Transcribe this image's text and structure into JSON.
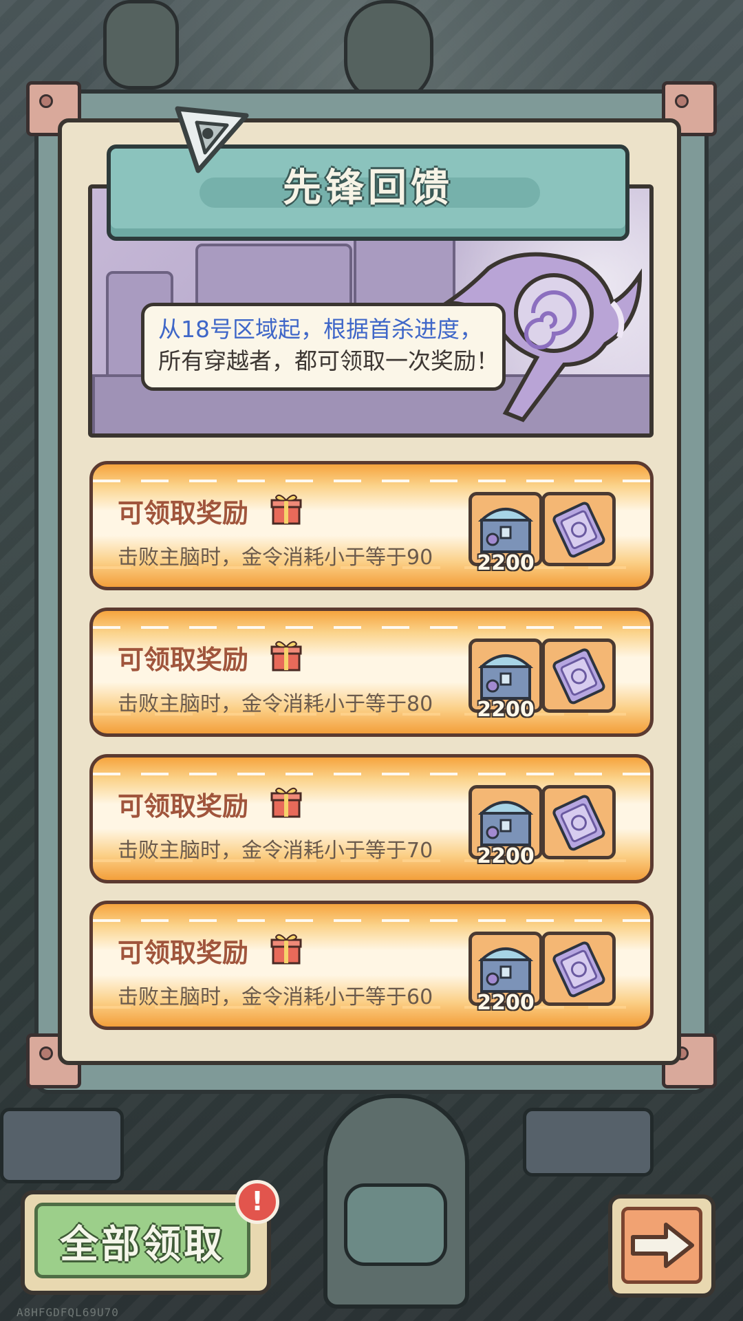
{
  "panel": {
    "title": "先锋回馈"
  },
  "banner": {
    "line1": "从18号区域起，根据首杀进度，",
    "line2": "所有穿越者，都可领取一次奖励！"
  },
  "rewards": [
    {
      "status": "可领取奖励",
      "description": "击败主脑时，金令消耗小于等于90",
      "items": [
        {
          "icon": "treasure-chest-icon",
          "quantity": "2200"
        },
        {
          "icon": "card-icon"
        }
      ]
    },
    {
      "status": "可领取奖励",
      "description": "击败主脑时，金令消耗小于等于80",
      "items": [
        {
          "icon": "treasure-chest-icon",
          "quantity": "2200"
        },
        {
          "icon": "card-icon"
        }
      ]
    },
    {
      "status": "可领取奖励",
      "description": "击败主脑时，金令消耗小于等于70",
      "items": [
        {
          "icon": "treasure-chest-icon",
          "quantity": "2200"
        },
        {
          "icon": "card-icon"
        }
      ]
    },
    {
      "status": "可领取奖励",
      "description": "击败主脑时，金令消耗小于等于60",
      "items": [
        {
          "icon": "treasure-chest-icon",
          "quantity": "2200"
        },
        {
          "icon": "card-icon"
        }
      ]
    }
  ],
  "actions": {
    "claim_all_label": "全部领取",
    "alert_badge": "!",
    "next_icon": "arrow-right-icon"
  },
  "footer": {
    "build_code": "A8HFGDFQL69U70"
  },
  "colors": {
    "accent_teal": "#8bc3bd",
    "row_orange": "#f6a43e",
    "status_text": "#a0553c",
    "banner_blue_text": "#3f67c8",
    "claim_green": "#9ccf8a",
    "alert_red": "#e2554d"
  }
}
